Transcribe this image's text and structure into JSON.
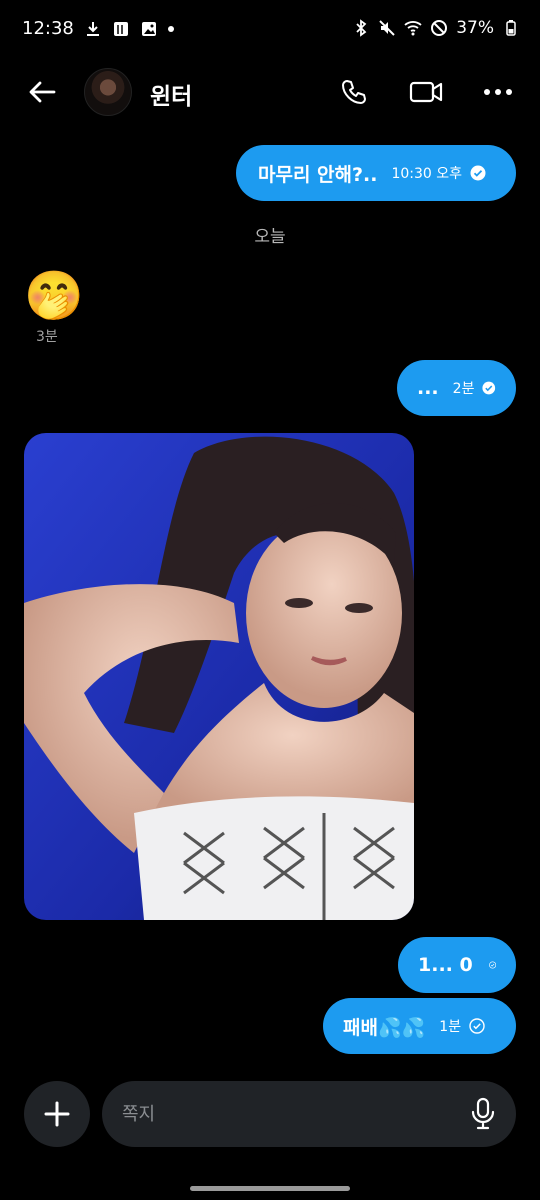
{
  "status_bar": {
    "time": "12:38",
    "battery": "37%",
    "left_icons": [
      "download-icon",
      "photo-collage-icon",
      "image-icon",
      "dot-icon"
    ],
    "right_icons": [
      "bluetooth-icon",
      "mute-icon",
      "wifi-icon",
      "do-not-disturb-icon",
      "battery-icon"
    ]
  },
  "header": {
    "contact_name": "윈터",
    "icons": [
      "back-arrow-icon",
      "phone-icon",
      "video-camera-icon",
      "more-dots-icon"
    ]
  },
  "messages": {
    "m1": {
      "text": "마무리 안해?..",
      "time": "10:30 오후",
      "status_icon": "check-filled-icon"
    },
    "date_separator": "오늘",
    "m2": {
      "emoji": "🤭",
      "time": "3분"
    },
    "m3": {
      "text": "...",
      "time": "2분",
      "status_icon": "check-filled-icon"
    },
    "m4": {
      "type": "image"
    },
    "m5": {
      "text": "1... 0",
      "time": "",
      "status_icon": "check-outline-icon"
    },
    "m6": {
      "text": "패배💦💦",
      "time": "1분",
      "status_icon": "check-outline-icon"
    }
  },
  "composer": {
    "placeholder": "쪽지",
    "icons": [
      "plus-icon",
      "microphone-icon"
    ]
  },
  "colors": {
    "background": "#000000",
    "bubble": "#1d9bf0",
    "composer": "#202327"
  }
}
